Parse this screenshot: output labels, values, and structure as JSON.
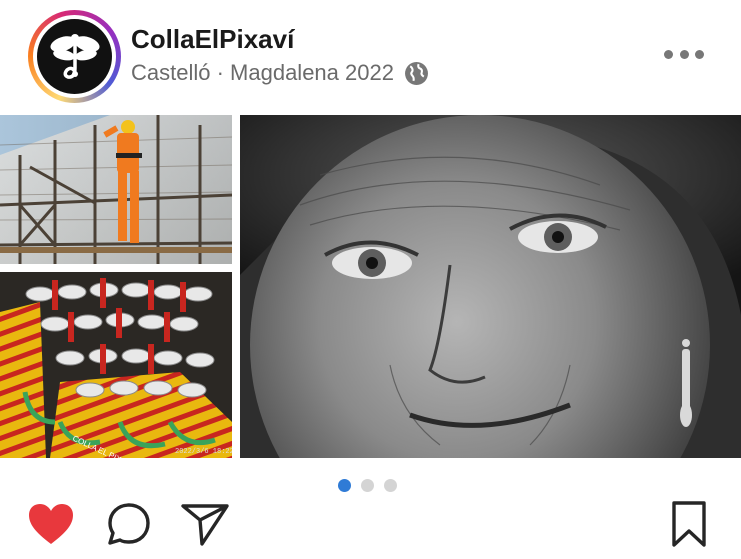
{
  "post": {
    "username": "CollaElPixaví",
    "location": "Castelló · Magdalena 2022",
    "location_icon": "globe-icon",
    "more_icon": "more-options-icon"
  },
  "photos": {
    "medals_timestamp": "2022/3/6 18:22",
    "medal_text": "COLLA EL PIXAVÍ"
  },
  "carousel": {
    "total": 3,
    "active_index": 0
  },
  "actions": {
    "liked": true,
    "like_icon": "heart-icon",
    "comment_icon": "comment-icon",
    "share_icon": "share-icon",
    "save_icon": "bookmark-icon"
  },
  "colors": {
    "like_red": "#e8383d",
    "dot_active": "#2f7bd6",
    "dot_inactive": "#d4d4d4"
  }
}
